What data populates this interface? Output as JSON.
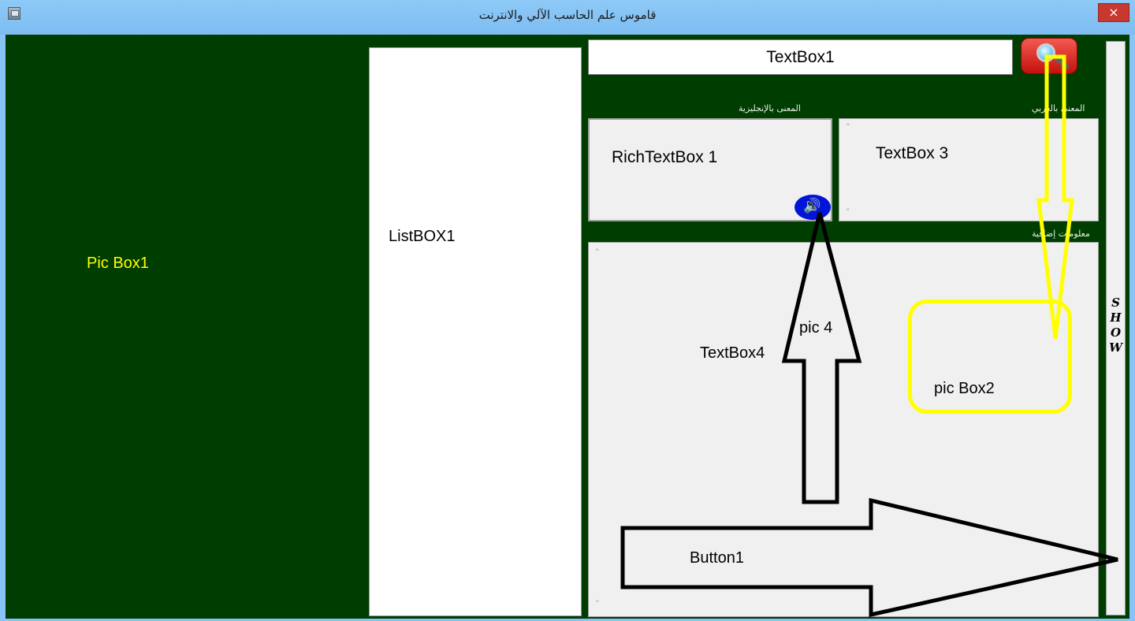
{
  "window": {
    "title": "قاموس علم الحاسب الآلي والانترنت",
    "close_label": "×"
  },
  "pic_box1": {
    "label": "Pic Box1"
  },
  "listbox": {
    "label": "ListBOX1"
  },
  "search": {
    "textbox_value": "TextBox1",
    "button_icon": "magnifier-icon"
  },
  "english_meaning": {
    "label": "المعنى بالإنجليزية",
    "value": "RichTextBox 1",
    "speaker_icon": "speaker-icon"
  },
  "arabic_meaning": {
    "label": "المعنى بالعربي",
    "value": "TextBox  3"
  },
  "extra_info": {
    "label": "معلومات إضافية",
    "value": "TextBox4"
  },
  "annotations": {
    "pic4": "pic 4",
    "pic_box2": "pic Box2",
    "button1": "Button1"
  },
  "show_button": {
    "label": "SHOW"
  },
  "colors": {
    "titlebar": "#87c4f5",
    "background": "#003d00",
    "highlight": "#ffff00",
    "close": "#c7382f",
    "speaker": "#0015d8"
  }
}
